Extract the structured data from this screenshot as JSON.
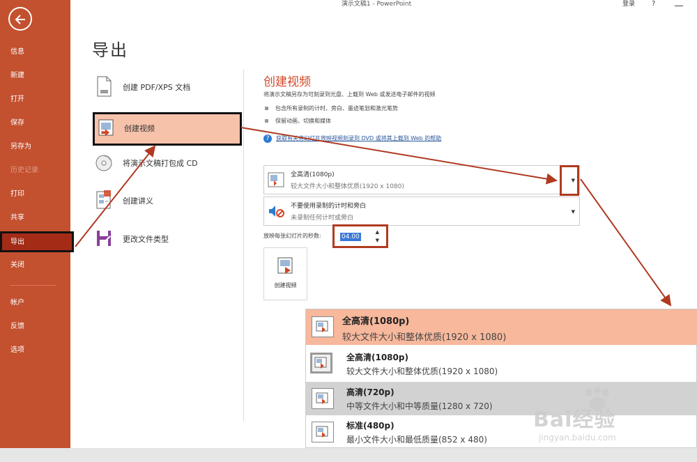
{
  "window": {
    "title": "演示文稿1 - PowerPoint",
    "signin": "登录",
    "help": "?"
  },
  "sidebar": {
    "items": [
      {
        "label": "信息"
      },
      {
        "label": "新建"
      },
      {
        "label": "打开"
      },
      {
        "label": "保存"
      },
      {
        "label": "另存为"
      },
      {
        "label": "历史记录",
        "disabled": true
      },
      {
        "label": "打印"
      },
      {
        "label": "共享"
      },
      {
        "label": "导出",
        "active": true
      },
      {
        "label": "关闭"
      },
      {
        "label": "帐户"
      },
      {
        "label": "反馈"
      },
      {
        "label": "选项"
      }
    ],
    "accent": "#c3502f"
  },
  "page": {
    "title": "导出"
  },
  "export_options": [
    {
      "label": "创建 PDF/XPS 文档",
      "icon": "pdf-document-icon"
    },
    {
      "label": "创建视频",
      "icon": "video-icon",
      "active": true
    },
    {
      "label": "将演示文稿打包成 CD",
      "icon": "cd-icon"
    },
    {
      "label": "创建讲义",
      "icon": "handout-icon"
    },
    {
      "label": "更改文件类型",
      "icon": "file-type-icon"
    }
  ],
  "video": {
    "title": "创建视频",
    "description": "将演示文稿另存为可刻录到光盘、上载到 Web 或发送电子邮件的视频",
    "bullets": [
      "包含所有录制的计时、旁白、墨迹笔划和激光笔势",
      "保留动画、切换和媒体"
    ],
    "help_link": "获取有关将幻灯片放映视频刻录到 DVD 或将其上载到 Web 的帮助",
    "quality": {
      "title": "全高清(1080p)",
      "desc": "较大文件大小和整体优质(1920 x 1080)"
    },
    "timing": {
      "title": "不要使用录制的计时和旁白",
      "desc": "未录制任何计时或旁白"
    },
    "seconds_label": "放映每张幻灯片的秒数:",
    "seconds_value": "04.00",
    "create_button": "创建视频"
  },
  "popup": {
    "items": [
      {
        "title": "全高清(1080p)",
        "desc": "较大文件大小和整体优质(1920 x 1080)",
        "state": "selected"
      },
      {
        "title": "全高清(1080p)",
        "desc": "较大文件大小和整体优质(1920 x 1080)",
        "state": "normal"
      },
      {
        "title": "高清(720p)",
        "desc": "中等文件大小和中等质量(1280 x 720)",
        "state": "hover"
      },
      {
        "title": "标准(480p)",
        "desc": "最小文件大小和最低质量(852 x 480)",
        "state": "normal"
      }
    ]
  },
  "watermark": {
    "logo": "Bai经验",
    "url": "jingyan.baidu.com"
  },
  "colors": {
    "accent": "#d24726",
    "highlight": "#f7c2aa",
    "annotation": "#b03a20"
  }
}
